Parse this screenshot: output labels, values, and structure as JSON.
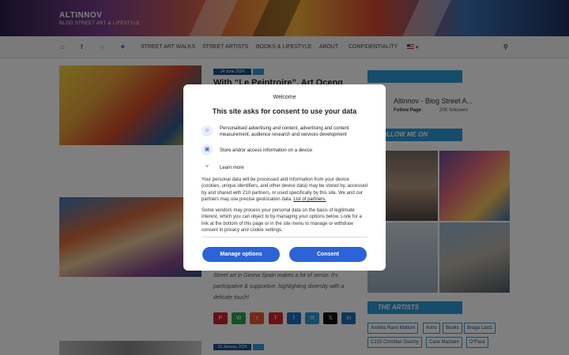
{
  "site": {
    "title": "ALTINNOV",
    "tagline": "BLOG STREET ART & LIFESTYLE"
  },
  "nav": {
    "icons": [
      "home-icon",
      "facebook-icon",
      "instagram-icon",
      "twitter-icon"
    ],
    "items": [
      "STREET ART WALKS",
      "STREET ARTISTS",
      "BOOKS & LIFESTYLE",
      "ABOUT",
      "CONFIDENTIALITY"
    ],
    "language": "▾"
  },
  "posts": [
    {
      "date": "24 June 2024",
      "title": "With “Le Peintroire”, Art Oceng"
    },
    {
      "date": "",
      "excerpt": "Street art in Girona Spain makes a lot of sense: it's participative & supportive, highlighting diversity with a delicate touch!"
    },
    {
      "date": "16 January 2024"
    }
  ],
  "share_buttons": [
    {
      "name": "pinterest",
      "glyph": "P",
      "color": "#c8232c"
    },
    {
      "name": "whatsapp",
      "glyph": "W",
      "color": "#2aa34a"
    },
    {
      "name": "reddit",
      "glyph": "r",
      "color": "#e9572f"
    },
    {
      "name": "flipboard",
      "glyph": "f",
      "color": "#d8222c"
    },
    {
      "name": "facebook",
      "glyph": "f",
      "color": "#1a6fc4"
    },
    {
      "name": "email",
      "glyph": "✉",
      "color": "#2b9bd6"
    },
    {
      "name": "x",
      "glyph": "𝕏",
      "color": "#111111"
    },
    {
      "name": "linkedin",
      "glyph": "in",
      "color": "#1b6fb0"
    }
  ],
  "sidebar": {
    "fb_page_name": "Altinnov - Blog Street A...",
    "fb_follow": "Follow Page",
    "fb_followers": "20K followers",
    "instagram_heading": "FOLLOW ME ON INSTAGRAM",
    "artists_heading": "THE ARTISTS",
    "artists": [
      "Andréa Ravo Mattoni",
      "Astro",
      "Books",
      "Braga Last1",
      "C215 Christian Guemy",
      "Case Maclaim",
      "D*Face"
    ]
  },
  "consent": {
    "brand": "Welcome",
    "title": "This site asks for consent to use your data",
    "purposes": [
      {
        "icon": "person-icon",
        "glyph": "☺",
        "text": "Personalised advertising and content, advertising and content measurement, audience research and services development"
      },
      {
        "icon": "device-icon",
        "glyph": "▣",
        "text": "Store and/or access information on a device"
      },
      {
        "icon": "chevron-down-icon",
        "glyph": "˅",
        "text": "Learn more"
      }
    ],
    "body1": "Your personal data will be processed and information from your device (cookies, unique identifiers, and other device data) may be stored by, accessed by and shared with 210 partners, or used specifically by this site. We and our partners may use precise geolocation data.",
    "partners_link": "List of partners.",
    "body2": "Some vendors may process your personal data on the basis of legitimate interest, which you can object to by managing your options below. Look for a link at the bottom of this page or in the site menu to manage or withdraw consent in privacy and cookie settings.",
    "manage_label": "Manage options",
    "consent_label": "Consent"
  }
}
